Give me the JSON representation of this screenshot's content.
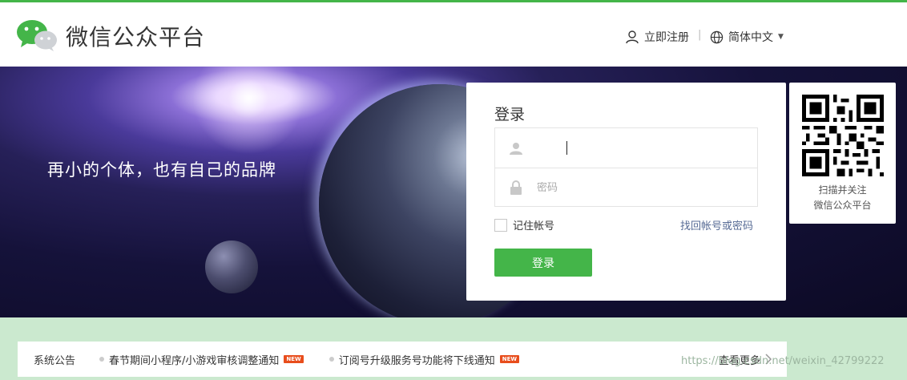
{
  "header": {
    "brand": "微信公众平台",
    "register_label": "立即注册",
    "separator": "|",
    "language_label": "简体中文"
  },
  "banner": {
    "slogan": "再小的个体，也有自己的品牌"
  },
  "login": {
    "title": "登录",
    "account_value": "",
    "password_placeholder": "密码",
    "remember_label": "记住帐号",
    "forgot_label": "找回帐号或密码",
    "submit_label": "登录"
  },
  "qr": {
    "caption_line1": "扫描并关注",
    "caption_line2": "微信公众平台"
  },
  "notices": {
    "label": "系统公告",
    "items": [
      {
        "text": "春节期间小程序/小游戏审核调整通知",
        "badge": "NEW"
      },
      {
        "text": "订阅号升级服务号功能将下线通知",
        "badge": "NEW"
      }
    ],
    "more_label": "查看更多",
    "watermark": "https://blog.csdn.net/weixin_42799222"
  },
  "colors": {
    "accent": "#44b549",
    "link": "#576b95",
    "notice_bg": "#cbe9cf"
  },
  "icons": [
    "wechat-logo",
    "user-icon",
    "globe-icon",
    "lock-icon",
    "chevron-right-icon"
  ]
}
